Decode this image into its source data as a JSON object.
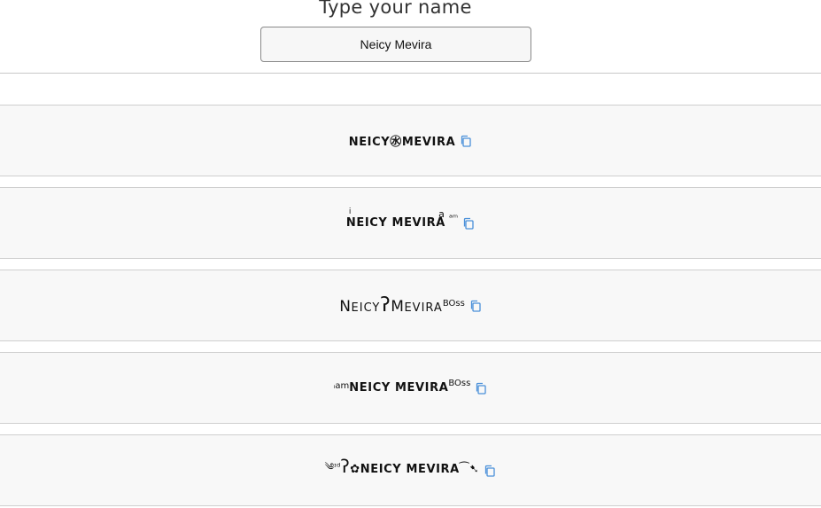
{
  "header": {
    "title": "Type your name",
    "input_value": "Neicy Mevira"
  },
  "styles": [
    {
      "text": "NEICY㊌MEVIRA"
    },
    {
      "prefix_sup": "i",
      "text": "NEICY MEVIRA",
      "suffix_sup": "ᵃᵐ",
      "mid_mark": "a"
    },
    {
      "first": "N",
      "first_small": "EICY",
      "mid": "ʔ",
      "second": "M",
      "second_small": "EVIRA",
      "suffix_sup": "BOss"
    },
    {
      "prefix_sup": "ᵢam",
      "text": "NEICY MEVIRA",
      "suffix_sup": "BOss"
    },
    {
      "prefix": "༄ᶦᵈ",
      "mid": "ʔ",
      "flower": "✿",
      "text": "NEICY MEVIRA",
      "suffix": "⁀➷"
    }
  ],
  "colors": {
    "copy_icon": "#4a90d9",
    "card_bg": "#f8f8f8",
    "border": "#cfcfcf"
  },
  "icons": {
    "copy": "copy-icon"
  }
}
